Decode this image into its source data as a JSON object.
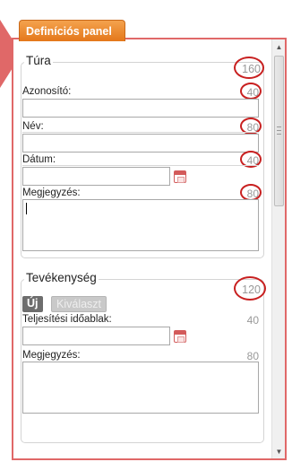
{
  "panel": {
    "tab_label": "Definíciós panel"
  },
  "tura": {
    "legend": "Túra",
    "count": "160",
    "fields": [
      {
        "label": "Azonosító:",
        "count": "40",
        "value": ""
      },
      {
        "label": "Név:",
        "count": "80",
        "value": ""
      },
      {
        "label": "Dátum:",
        "count": "40",
        "value": ""
      },
      {
        "label": "Megjegyzés:",
        "count": "80",
        "value": ""
      }
    ]
  },
  "tevekenyseg": {
    "legend": "Tevékenység",
    "count": "120",
    "new_button": "Új",
    "select_button": "Kiválaszt",
    "fields": [
      {
        "label": "Teljesítési időablak:",
        "count": "40",
        "value": ""
      },
      {
        "label": "Megjegyzés:",
        "count": "80",
        "value": ""
      }
    ]
  },
  "icons": {
    "calendar": "calendar-icon",
    "scroll_up": "scroll-up-arrow-icon",
    "scroll_down": "scroll-down-arrow-icon",
    "pointer": "pointer-arrow-icon"
  },
  "colors": {
    "tab_orange": "#e4781b",
    "frame_red": "#e06868",
    "annotation_red": "#c82020"
  }
}
